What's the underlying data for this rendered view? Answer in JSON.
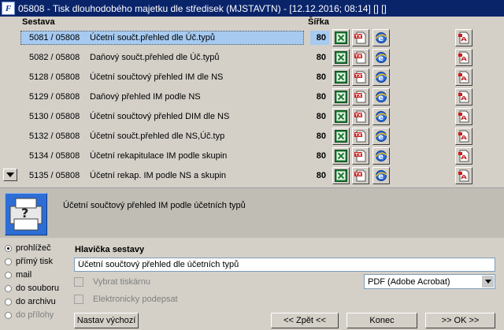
{
  "window": {
    "title": "05808 - Tisk dlouhodobého majetku dle středisek (MJSTAVTN) - [12.12.2016; 08:14] [] []",
    "app_icon_text": "F"
  },
  "columns": {
    "sestava": "Sestava",
    "sirka": "Šířka"
  },
  "reports": [
    {
      "code": "5081 / 05808",
      "name": "Účetní součt.přehled dle Úč.typů",
      "width": "80",
      "selected": true
    },
    {
      "code": "5082 / 05808",
      "name": "Daňový součt.přehled dle Úč.typů",
      "width": "80"
    },
    {
      "code": "5128 / 05808",
      "name": "Účetní součtový přehled IM dle NS",
      "width": "80"
    },
    {
      "code": "5129 / 05808",
      "name": "Daňový přehled IM podle NS",
      "width": "80"
    },
    {
      "code": "5130 / 05808",
      "name": "Účetní součtový přehled DIM dle NS",
      "width": "80"
    },
    {
      "code": "5132 / 05808",
      "name": "Účetní součt.přehled dle NS,Úč.typ",
      "width": "80"
    },
    {
      "code": "5134 / 05808",
      "name": "Účetní rekapitulace IM podle skupin",
      "width": "80"
    },
    {
      "code": "5135 / 05808",
      "name": "Účetní rekap. IM podle NS a skupin",
      "width": "80"
    }
  ],
  "description": "Účetní součtový přehled IM podle účetních typů",
  "output": {
    "options": [
      "prohlížeč",
      "přímý tisk",
      "mail",
      "do souboru",
      "do archivu",
      "do přílohy"
    ],
    "selected": "prohlížeč"
  },
  "header_section": {
    "label": "Hlavička sestavy",
    "value": "Účetní součtový přehled dle účetních typů"
  },
  "checks": {
    "select_printer": "Vybrat tiskárnu",
    "electronic_signature": "Elektronicky podepsat"
  },
  "printer_select": {
    "value": "PDF (Adobe Acrobat)"
  },
  "buttons": {
    "default_settings": "Nastav výchozí",
    "back": "<< Zpět <<",
    "end": "Konec",
    "ok": ">> OK >>"
  }
}
